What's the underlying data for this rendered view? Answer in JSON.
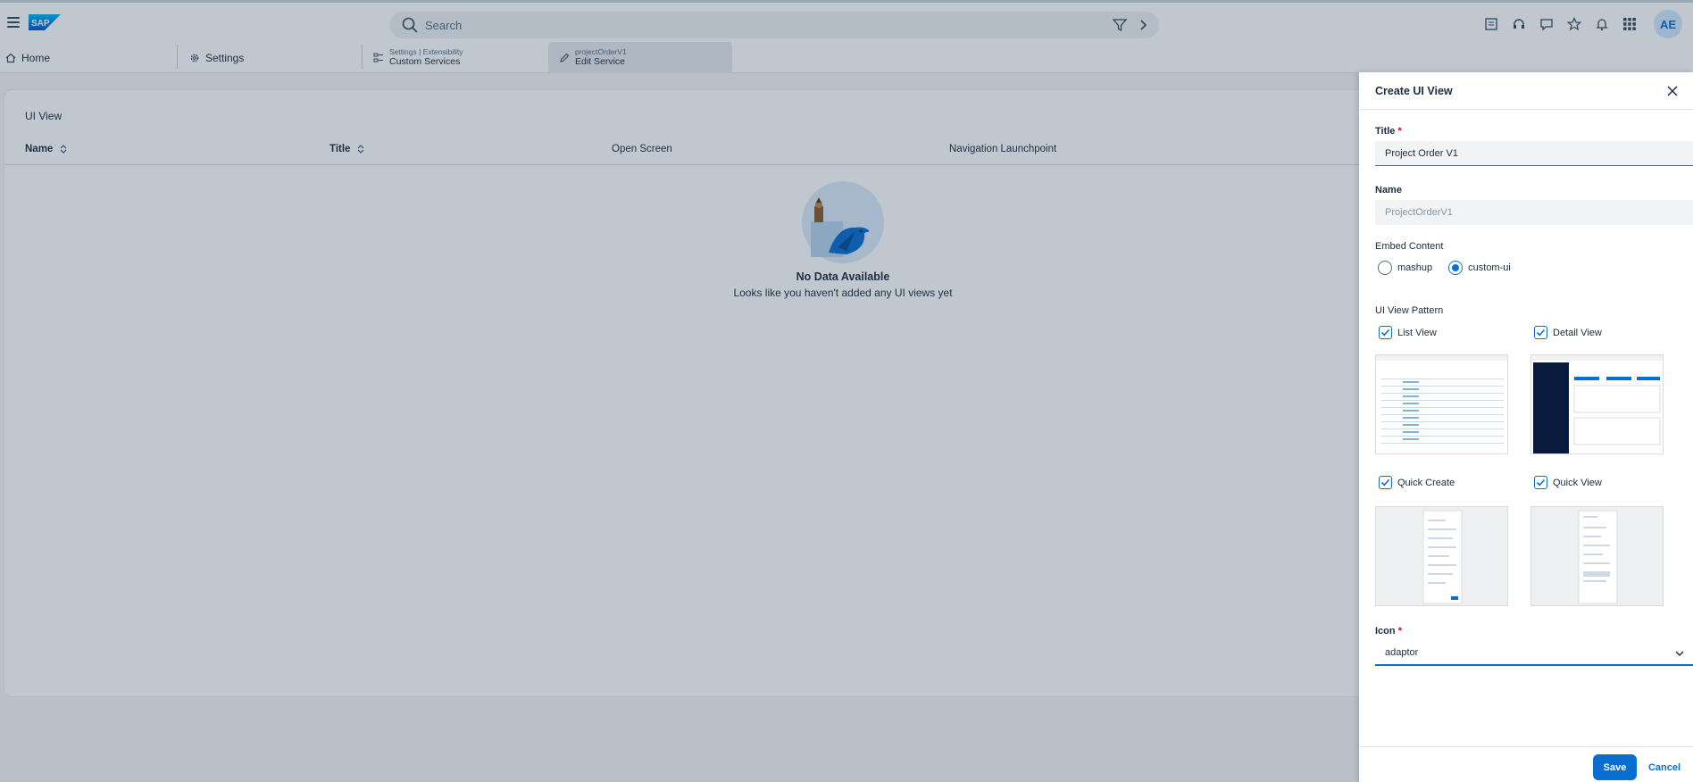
{
  "shell": {
    "logo_text": "SAP",
    "search_placeholder": "Search",
    "avatar_initials": "AE",
    "icons": [
      "hamburger-icon",
      "search-icon",
      "filter-icon",
      "chevron-right-icon",
      "reports-icon",
      "headset-icon",
      "chat-icon",
      "star-icon",
      "bell-icon",
      "grid-icon"
    ]
  },
  "tabs": [
    {
      "label": "Home",
      "icon": "home-icon"
    },
    {
      "label": "Settings",
      "icon": "gear-icon"
    },
    {
      "small": "Settings | Extensibility",
      "label": "Custom Services",
      "icon": "services-icon"
    },
    {
      "small": "projectOrderV1",
      "label": "Edit Service",
      "icon": "pencil-icon"
    }
  ],
  "main": {
    "title": "UI View",
    "columns": [
      "Name",
      "Title",
      "Open Screen",
      "Navigation Launchpoint"
    ],
    "empty_title": "No Data Available",
    "empty_sub": "Looks like you haven't added any UI views yet"
  },
  "panel": {
    "title": "Create UI View",
    "title_label": "Title",
    "title_value": "Project Order V1",
    "name_label": "Name",
    "name_value": "ProjectOrderV1",
    "embed_label": "Embed Content",
    "embed_options": [
      "mashup",
      "custom-ui"
    ],
    "embed_selected": "custom-ui",
    "pattern_label": "UI View Pattern",
    "patterns": [
      "List View",
      "Detail View",
      "Quick Create",
      "Quick View"
    ],
    "icon_label": "Icon",
    "icon_value": "adaptor",
    "save_label": "Save",
    "cancel_label": "Cancel"
  },
  "colors": {
    "accent": "#0a6ed1",
    "required": "#d0021b",
    "text": "#1d2d3e",
    "overlay": "rgba(30,55,82,0.28)"
  }
}
